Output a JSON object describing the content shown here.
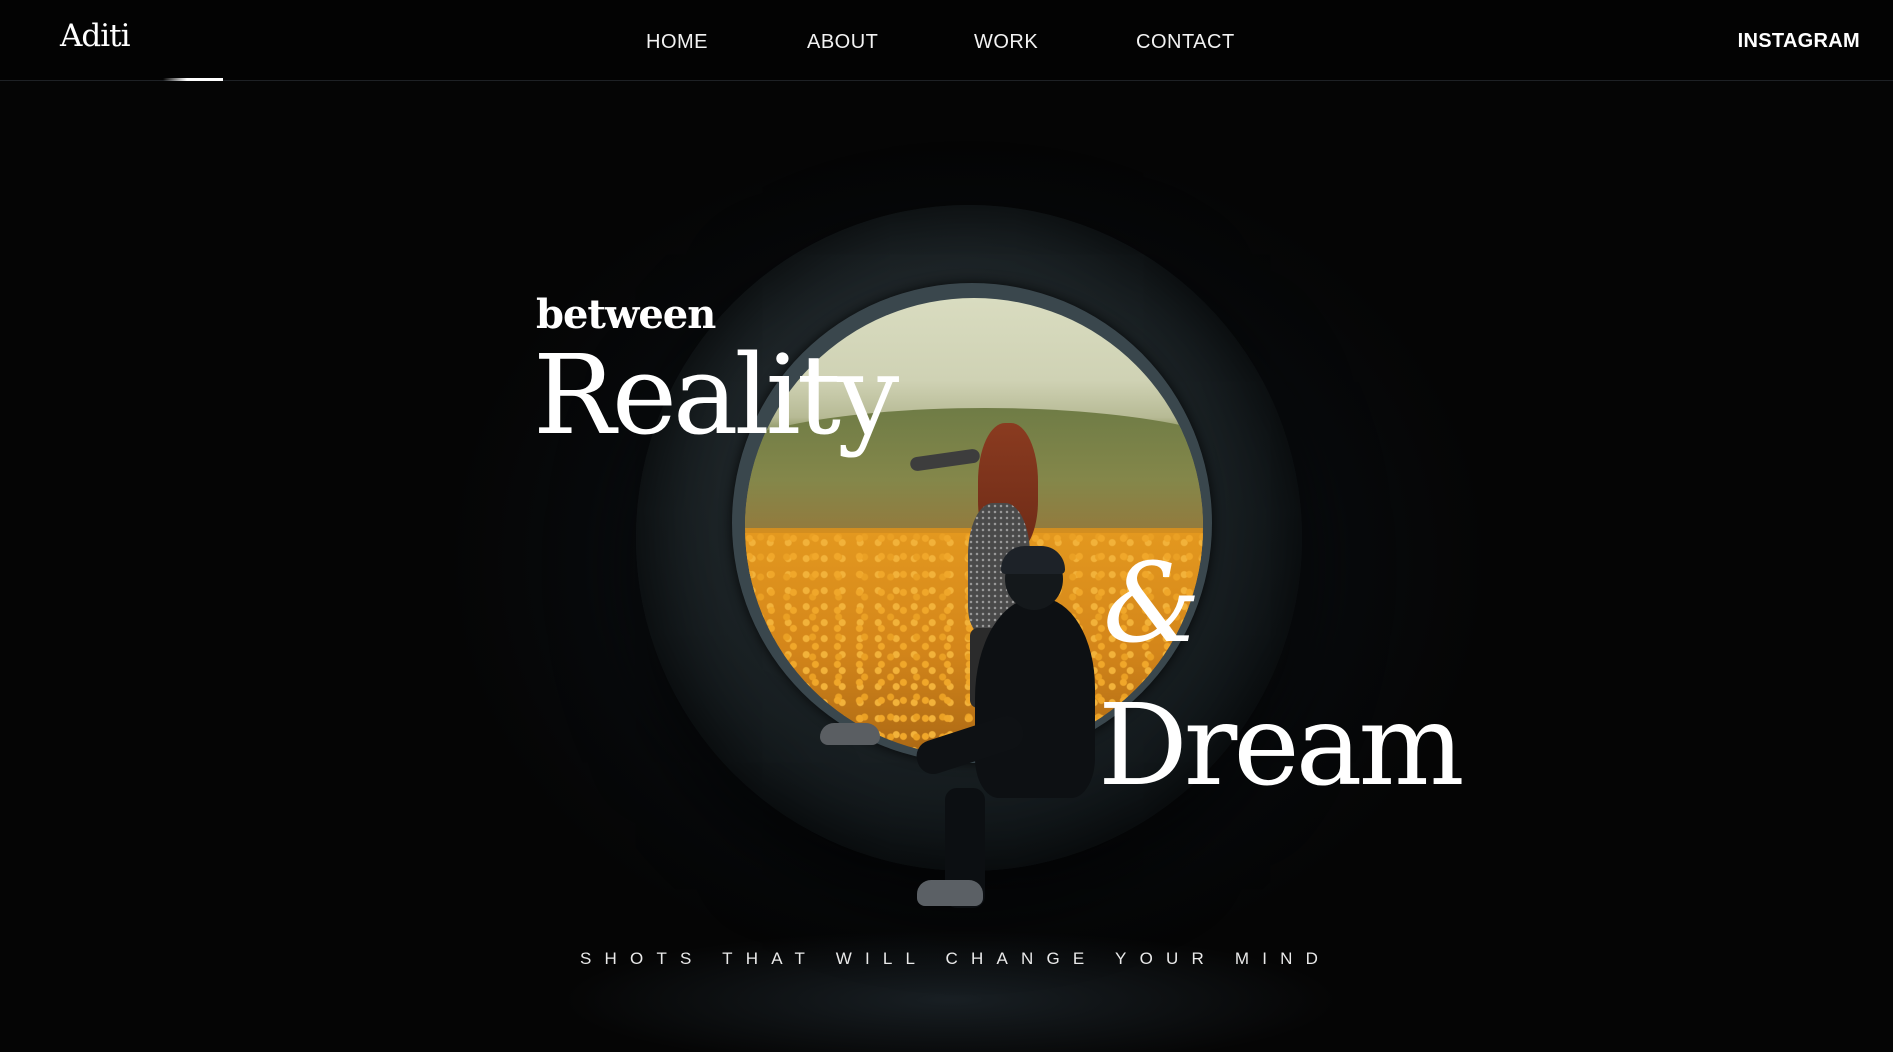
{
  "header": {
    "logo": "Aditi",
    "nav": [
      {
        "label": "HOME"
      },
      {
        "label": "ABOUT"
      },
      {
        "label": "WORK"
      },
      {
        "label": "CONTACT"
      }
    ],
    "social_link": "INSTAGRAM"
  },
  "hero": {
    "word_between": "between",
    "word_reality": "Reality",
    "ampersand": "&",
    "word_dream": "Dream",
    "tagline": "SHOTS THAT WILL CHANGE YOUR MIND"
  },
  "colors": {
    "background": "#050505",
    "text": "#ffffff",
    "accent_field": "#e0971f"
  }
}
